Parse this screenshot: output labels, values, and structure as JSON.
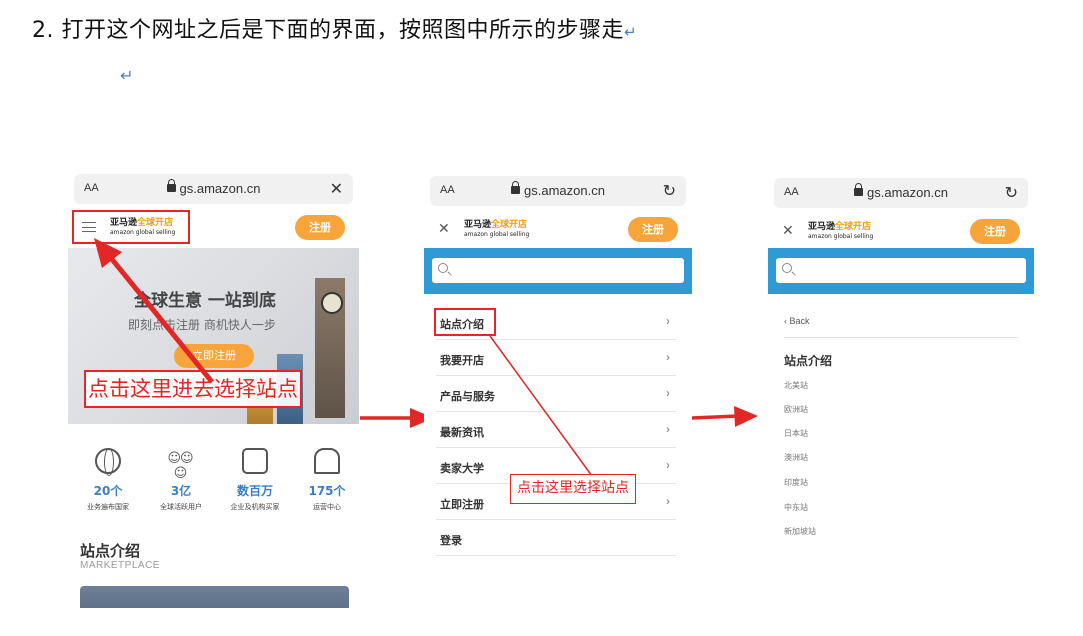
{
  "doc": {
    "heading": "2. 打开这个网址之后是下面的界面，按照图中所示的步骤走",
    "return_mark": "↵"
  },
  "browser": {
    "aa": "AA",
    "url": "gs.amazon.cn",
    "close_glyph": "✕",
    "reload_glyph": "↻"
  },
  "site_header": {
    "logo_line1_prefix": "亚马逊",
    "logo_line1_accent": "全球开店",
    "logo_line2": "amazon global selling",
    "register": "注册",
    "close_glyph": "✕"
  },
  "screen1": {
    "hero_title": "全球生意 一站到底",
    "hero_subtitle": "即刻点击注册 商机快人一步",
    "hero_button": "立即注册",
    "stats": [
      {
        "icon": "globe-icon",
        "value": "20个",
        "label": "业务遍布国家"
      },
      {
        "icon": "people-icon",
        "value": "3亿",
        "label": "全球活跃用户"
      },
      {
        "icon": "building-icon",
        "value": "数百万",
        "label": "企业及机构买家"
      },
      {
        "icon": "warehouse-icon",
        "value": "175个",
        "label": "运营中心"
      }
    ],
    "marketplace_title": "站点介绍",
    "marketplace_subtitle": "MARKETPLACE",
    "annotation": "点击这里进去选择站点"
  },
  "screen2": {
    "menu": [
      "站点介绍",
      "我要开店",
      "产品与服务",
      "最新资讯",
      "卖家大学",
      "立即注册",
      "登录"
    ],
    "chevron": "›",
    "annotation": "点击这里选择站点"
  },
  "screen3": {
    "back": "‹ Back",
    "title": "站点介绍",
    "sites": [
      "北美站",
      "欧洲站",
      "日本站",
      "澳洲站",
      "印度站",
      "中东站",
      "新加坡站"
    ]
  },
  "colors": {
    "accent_orange": "#f7a53b",
    "search_blue": "#2e9ad6",
    "annotation_red": "#e32626",
    "stat_blue": "#3a7fc1"
  }
}
